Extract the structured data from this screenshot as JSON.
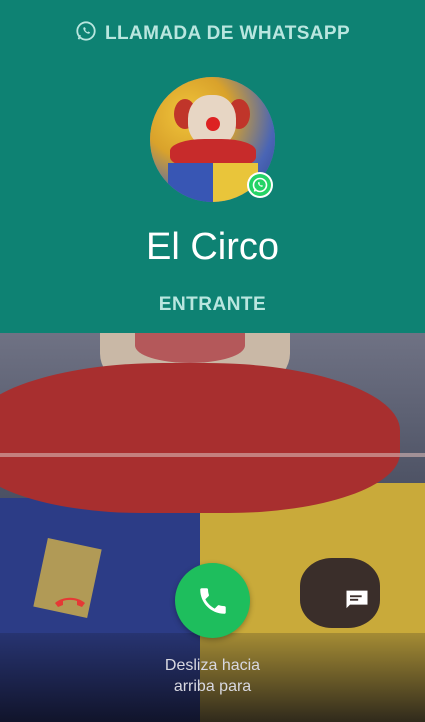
{
  "header": {
    "call_type_label": "LLAMADA DE WHATSAPP",
    "contact_name": "El Circo",
    "status": "ENTRANTE",
    "background_color": "#0e8273"
  },
  "avatar": {
    "icon": "whatsapp-badge-icon"
  },
  "actions": {
    "decline_icon": "phone-hangup-icon",
    "accept_icon": "phone-icon",
    "message_icon": "message-icon",
    "accept_color": "#1ebe5d",
    "decline_color": "#e53935"
  },
  "hint": {
    "line1": "Desliza hacia",
    "line2": "arriba para"
  }
}
